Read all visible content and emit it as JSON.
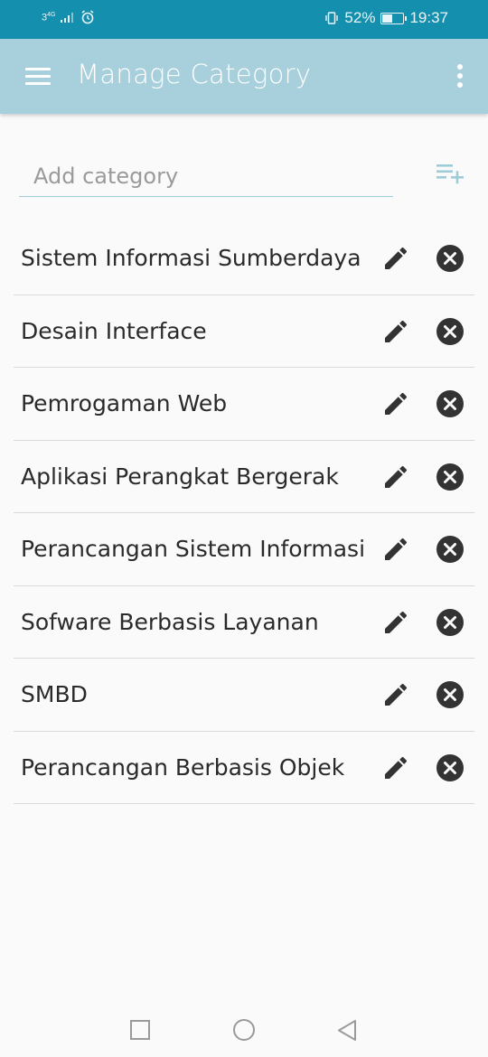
{
  "status_bar": {
    "network": "3",
    "network_type": "4G",
    "battery_percent": "52%",
    "battery_level": 0.52,
    "time": "19:37",
    "icons": [
      "signal-icon",
      "alarm-icon",
      "vibrate-icon",
      "battery-icon"
    ]
  },
  "app_bar": {
    "title": "Manage Category",
    "menu_icon": "hamburger-menu-icon",
    "overflow_icon": "more-vertical-icon",
    "color": "#a7d0dc"
  },
  "add_category": {
    "placeholder": "Add category",
    "value": "",
    "button_icon": "playlist-add-icon",
    "accent": "#9ecbd8"
  },
  "categories": [
    {
      "label": "Sistem Informasi Sumberdaya"
    },
    {
      "label": "Desain Interface"
    },
    {
      "label": "Pemrogaman Web"
    },
    {
      "label": "Aplikasi Perangkat Bergerak"
    },
    {
      "label": "Perancangan Sistem Informasi"
    },
    {
      "label": "Sofware Berbasis Layanan"
    },
    {
      "label": "SMBD"
    },
    {
      "label": "Perancangan Berbasis Objek"
    }
  ],
  "row_actions": {
    "edit_icon": "pencil-icon",
    "delete_icon": "close-circle-icon"
  },
  "nav_bar": {
    "buttons": [
      "recents-square-icon",
      "home-circle-icon",
      "back-triangle-icon"
    ]
  }
}
